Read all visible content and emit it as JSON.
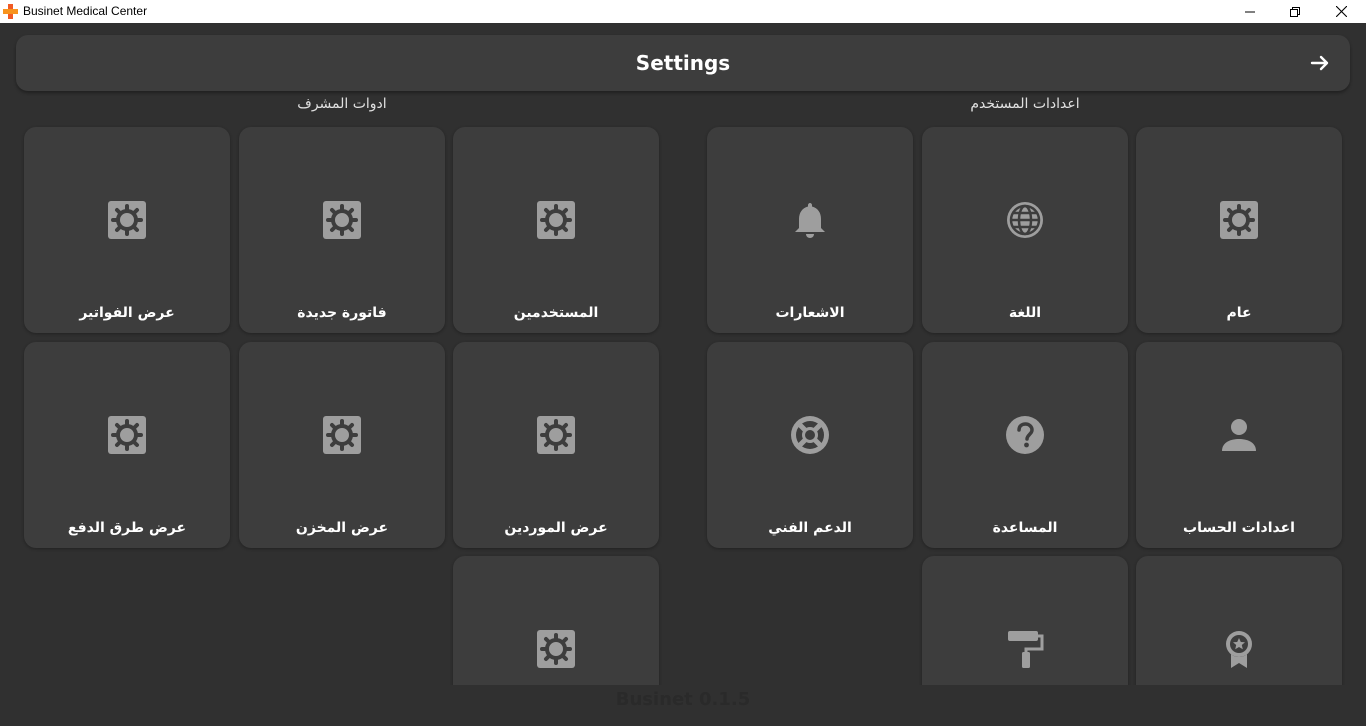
{
  "window": {
    "title": "Businet Medical Center",
    "controls": [
      "minimize",
      "restore",
      "close"
    ]
  },
  "header": {
    "title": "Settings",
    "back_icon": "arrow-right-icon"
  },
  "sections": {
    "user_settings": {
      "title": "اعدادات المستخدم"
    },
    "admin_tools": {
      "title": "ادوات المشرف"
    }
  },
  "user_settings_items": [
    {
      "label": "عام",
      "icon": "gear-icon"
    },
    {
      "label": "اللغة",
      "icon": "globe-icon"
    },
    {
      "label": "الاشعارات",
      "icon": "bell-icon"
    },
    {
      "label": "اعدادات الحساب",
      "icon": "person-icon"
    },
    {
      "label": "المساعدة",
      "icon": "help-icon"
    },
    {
      "label": "الدعم الفني",
      "icon": "lifebuoy-icon"
    },
    {
      "label": "",
      "icon": "award-icon"
    },
    {
      "label": "",
      "icon": "paint-roller-icon"
    }
  ],
  "admin_tools_items": [
    {
      "label": "المستخدمين",
      "icon": "gear-icon"
    },
    {
      "label": "فاتورة جديدة",
      "icon": "gear-icon"
    },
    {
      "label": "عرض الفواتير",
      "icon": "gear-icon"
    },
    {
      "label": "عرض الموردين",
      "icon": "gear-icon"
    },
    {
      "label": "عرض المخزن",
      "icon": "gear-icon"
    },
    {
      "label": "عرض طرق الدفع",
      "icon": "gear-icon"
    },
    {
      "label": "",
      "icon": "gear-icon"
    }
  ],
  "footer": {
    "version": "Businet 0.1.5"
  },
  "colors": {
    "background": "#303030",
    "card": "#3d3d3d",
    "icon": "#9e9e9e",
    "text": "#ffffff"
  }
}
